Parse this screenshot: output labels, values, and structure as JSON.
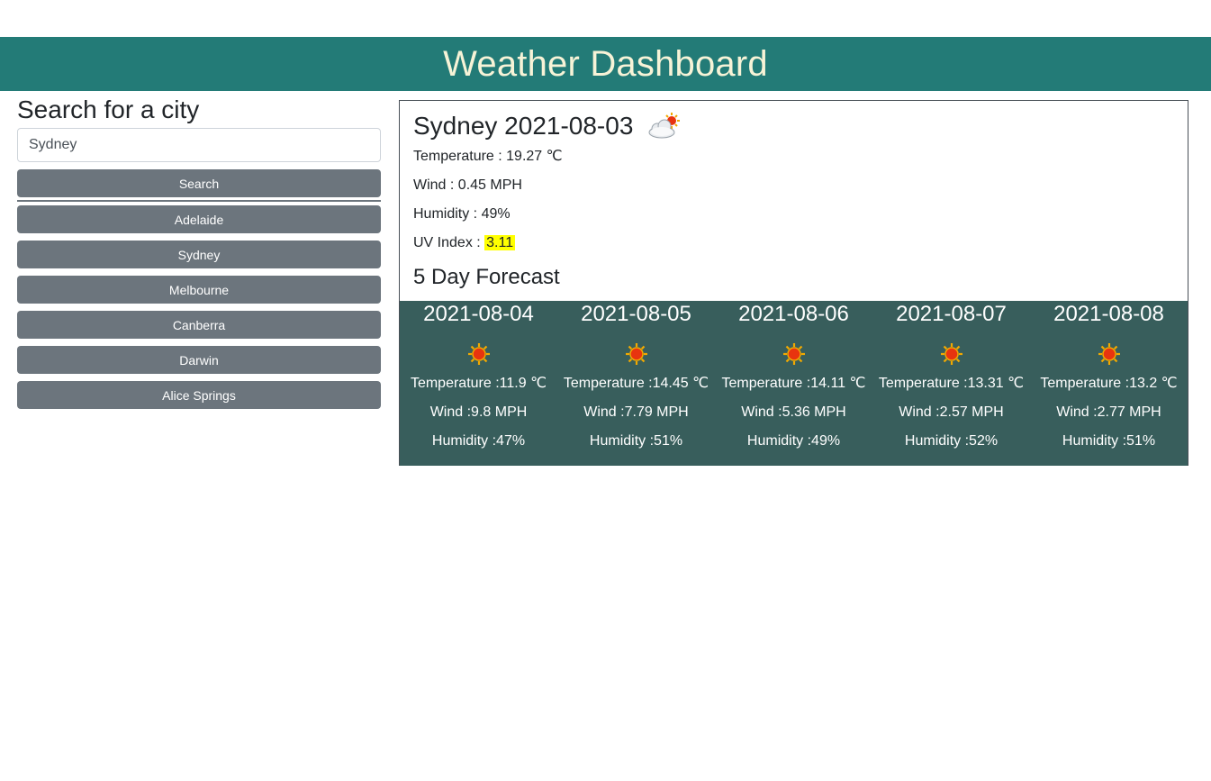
{
  "header": {
    "title": "Weather Dashboard"
  },
  "colors": {
    "header_bg": "#237b77",
    "header_text": "#f7f3d7",
    "forecast_bg": "#385e5c",
    "button_bg": "#6c757d",
    "uv_highlight": "#ffff00"
  },
  "sidebar": {
    "heading": "Search for a city",
    "search_value": "Sydney",
    "search_button": "Search",
    "cities": [
      "Adelaide",
      "Sydney",
      "Melbourne",
      "Canberra",
      "Darwin",
      "Alice Springs"
    ]
  },
  "current": {
    "title": "Sydney 2021-08-03",
    "icon": "cloud-sun-icon",
    "temperature": "Temperature : 19.27 ℃",
    "wind": "Wind : 0.45 MPH",
    "humidity": "Humidity : 49%",
    "uv_label": "UV Index : ",
    "uv_value": "3.11"
  },
  "forecast": {
    "title": "5 Day Forecast",
    "days": [
      {
        "date": "2021-08-04",
        "icon": "sun-icon",
        "temp": "Temperature :11.9 ℃",
        "wind": "Wind :9.8 MPH",
        "humidity": "Humidity :47%"
      },
      {
        "date": "2021-08-05",
        "icon": "sun-icon",
        "temp": "Temperature :14.45 ℃",
        "wind": "Wind :7.79 MPH",
        "humidity": "Humidity :51%"
      },
      {
        "date": "2021-08-06",
        "icon": "sun-icon",
        "temp": "Temperature :14.11 ℃",
        "wind": "Wind :5.36 MPH",
        "humidity": "Humidity :49%"
      },
      {
        "date": "2021-08-07",
        "icon": "sun-icon",
        "temp": "Temperature :13.31 ℃",
        "wind": "Wind :2.57 MPH",
        "humidity": "Humidity :52%"
      },
      {
        "date": "2021-08-08",
        "icon": "sun-icon",
        "temp": "Temperature :13.2 ℃",
        "wind": "Wind :2.77 MPH",
        "humidity": "Humidity :51%"
      }
    ]
  }
}
